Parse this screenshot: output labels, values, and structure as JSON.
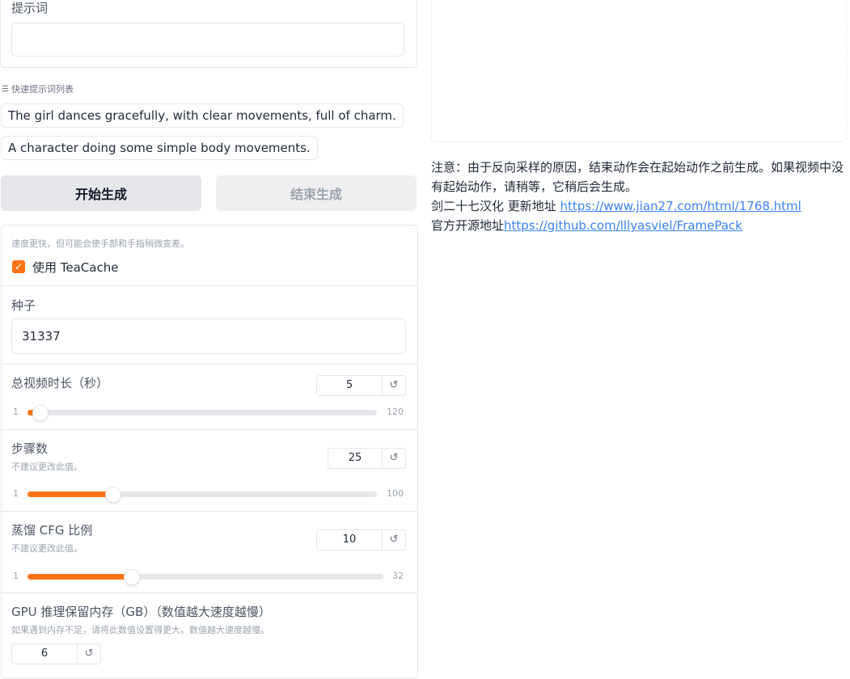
{
  "prompt": {
    "label": "提示词",
    "value": ""
  },
  "quick_prompts": {
    "label": "快速提示词列表",
    "items": [
      "The girl dances gracefully, with clear movements, full of charm.",
      "A character doing some simple body movements."
    ]
  },
  "buttons": {
    "start": "开始生成",
    "end": "结束生成"
  },
  "teacache": {
    "info": "速度更快，但可能会使手部和手指稍微变差。",
    "label": "使用 TeaCache",
    "checked": true
  },
  "seed": {
    "label": "种子",
    "value": "31337"
  },
  "duration": {
    "label": "总视频时长（秒）",
    "value": "5",
    "min": "1",
    "max": "120"
  },
  "steps": {
    "label": "步骤数",
    "info": "不建议更改此值。",
    "value": "25",
    "min": "1",
    "max": "100"
  },
  "cfg": {
    "label": "蒸馏 CFG 比例",
    "info": "不建议更改此值。",
    "value": "10",
    "min": "1",
    "max": "32"
  },
  "gpu": {
    "label": "GPU 推理保留内存（GB）（数值越大速度越慢）",
    "info": "如果遇到内存不足，请将此数值设置得更大。数值越大速度越慢。",
    "value": "6"
  },
  "note": {
    "line1": "注意：由于反向采样的原因，结束动作会在起始动作之前生成。如果视频中没有起始动作，请稍等，它稍后会生成。",
    "line2_prefix": "剑二十七汉化 更新地址 ",
    "line2_link": "https://www.jian27.com/html/1768.html",
    "line3_prefix": "官方开源地址",
    "line3_link": "https://github.com/lllyasviel/FramePack"
  },
  "colors": {
    "accent": "#f97316",
    "link": "#3b82f6"
  }
}
